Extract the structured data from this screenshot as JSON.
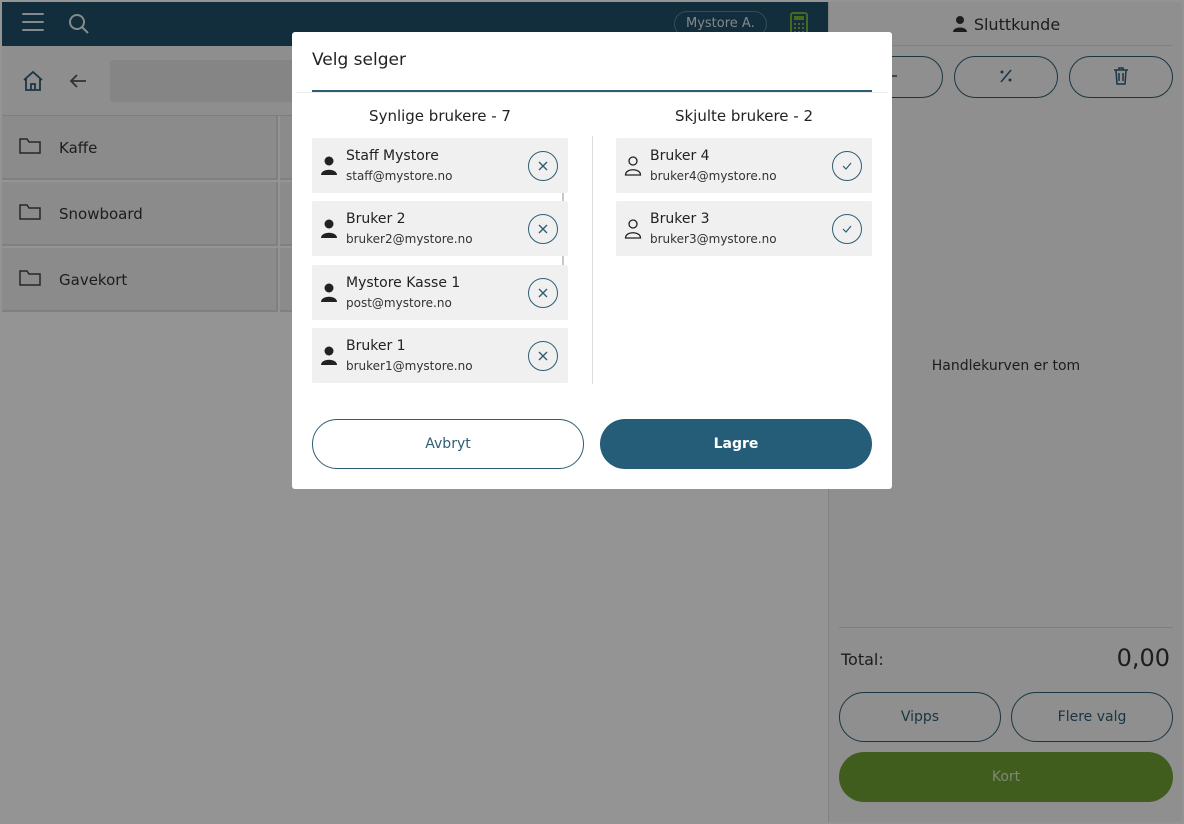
{
  "topbar": {
    "user_label": "Mystore A."
  },
  "categories": [
    {
      "label": "Kaffe"
    },
    {
      "label": "Snowboard"
    },
    {
      "label": "Gavekort"
    }
  ],
  "cart": {
    "customer": "Sluttkunde",
    "empty_text": "Handlekurven er tom",
    "total_label": "Total:",
    "total_value": "0,00",
    "vipps_label": "Vipps",
    "more_label": "Flere valg",
    "card_label": "Kort",
    "tools": [
      "minus-icon",
      "percent-icon",
      "trash-icon"
    ]
  },
  "modal": {
    "title": "Velg selger",
    "visible_title": "Synlige brukere - 7",
    "hidden_title": "Skjulte brukere - 2",
    "visible_users": [
      {
        "name": "Staff Mystore",
        "email": "staff@mystore.no"
      },
      {
        "name": "Bruker 2",
        "email": "bruker2@mystore.no"
      },
      {
        "name": "Mystore Kasse 1",
        "email": "post@mystore.no"
      },
      {
        "name": "Bruker 1",
        "email": "bruker1@mystore.no"
      }
    ],
    "hidden_users": [
      {
        "name": "Bruker 4",
        "email": "bruker4@mystore.no"
      },
      {
        "name": "Bruker 3",
        "email": "bruker3@mystore.no"
      }
    ],
    "cancel_label": "Avbryt",
    "save_label": "Lagre"
  },
  "colors": {
    "primary": "#255c77",
    "topbar": "#1f4f66",
    "accent_green": "#6ea035"
  }
}
